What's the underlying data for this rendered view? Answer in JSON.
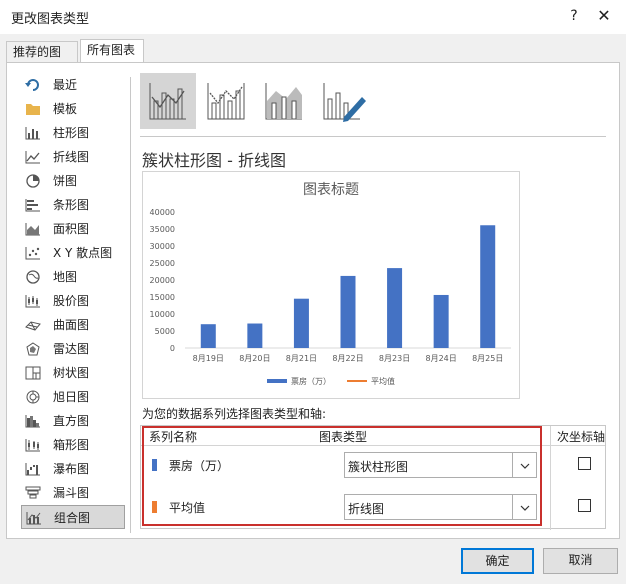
{
  "window": {
    "title": "更改图表类型",
    "help_label": "?",
    "close_label": "✕"
  },
  "tabs": [
    {
      "label": "推荐的图表"
    },
    {
      "label": "所有图表"
    }
  ],
  "sidebar": {
    "items": [
      {
        "label": "最近",
        "icon": "recent-icon"
      },
      {
        "label": "模板",
        "icon": "folder-icon"
      },
      {
        "label": "柱形图",
        "icon": "column-chart-icon"
      },
      {
        "label": "折线图",
        "icon": "line-chart-icon"
      },
      {
        "label": "饼图",
        "icon": "pie-chart-icon"
      },
      {
        "label": "条形图",
        "icon": "bar-chart-icon"
      },
      {
        "label": "面积图",
        "icon": "area-chart-icon"
      },
      {
        "label": "X Y 散点图",
        "icon": "scatter-chart-icon"
      },
      {
        "label": "地图",
        "icon": "map-chart-icon"
      },
      {
        "label": "股价图",
        "icon": "stock-chart-icon"
      },
      {
        "label": "曲面图",
        "icon": "surface-chart-icon"
      },
      {
        "label": "雷达图",
        "icon": "radar-chart-icon"
      },
      {
        "label": "树状图",
        "icon": "treemap-chart-icon"
      },
      {
        "label": "旭日图",
        "icon": "sunburst-chart-icon"
      },
      {
        "label": "直方图",
        "icon": "histogram-chart-icon"
      },
      {
        "label": "箱形图",
        "icon": "box-chart-icon"
      },
      {
        "label": "瀑布图",
        "icon": "waterfall-chart-icon"
      },
      {
        "label": "漏斗图",
        "icon": "funnel-chart-icon"
      },
      {
        "label": "组合图",
        "icon": "combo-chart-icon"
      }
    ],
    "active_index": 18
  },
  "combo_title": "簇状柱形图 - 折线图",
  "chart_data": {
    "type": "bar",
    "title": "图表标题",
    "categories": [
      "8月19日",
      "8月20日",
      "8月21日",
      "8月22日",
      "8月23日",
      "8月24日",
      "8月25日"
    ],
    "series": [
      {
        "name": "票房（万）",
        "type": "bar",
        "color": "#4472c4",
        "values": [
          7000,
          7200,
          14500,
          21200,
          23500,
          15600,
          36100
        ]
      },
      {
        "name": "平均值",
        "type": "line",
        "color": "#ed7d31",
        "values": []
      }
    ],
    "ylim": [
      0,
      40000
    ],
    "yticks": [
      0,
      5000,
      10000,
      15000,
      20000,
      25000,
      30000,
      35000,
      40000
    ],
    "grid": false,
    "legend": "bottom"
  },
  "series_hint": "为您的数据系列选择图表类型和轴:",
  "series_table": {
    "headers": {
      "name": "系列名称",
      "type": "图表类型",
      "secondary": "次坐标轴"
    },
    "rows": [
      {
        "name": "票房（万）",
        "color": "#4472c4",
        "chart_type": "簇状柱形图",
        "secondary": false
      },
      {
        "name": "平均值",
        "color": "#ed7d31",
        "chart_type": "折线图",
        "secondary": false
      }
    ]
  },
  "buttons": {
    "ok": "确定",
    "cancel": "取消"
  }
}
